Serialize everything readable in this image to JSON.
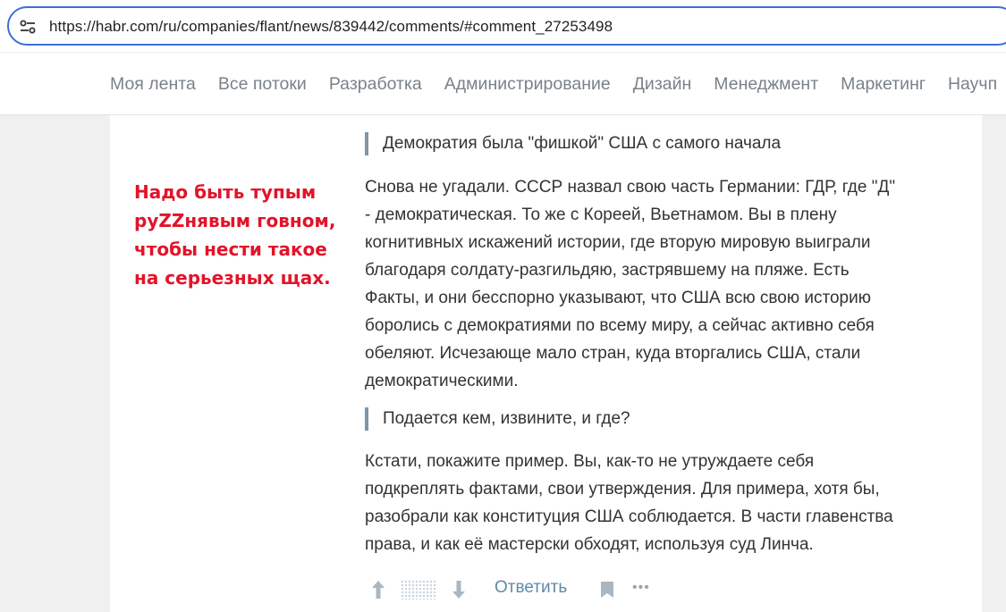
{
  "browser": {
    "url": "https://habr.com/ru/companies/flant/news/839442/comments/#comment_27253498"
  },
  "nav": {
    "items": [
      "Моя лента",
      "Все потоки",
      "Разработка",
      "Администрирование",
      "Дизайн",
      "Менеджмент",
      "Маркетинг",
      "Научп"
    ]
  },
  "side_note": {
    "lines": [
      "Надо быть тупым",
      "руZZнявым говном,",
      "чтобы нести такое",
      "на серьезных щах."
    ],
    "color": "#e3132a"
  },
  "comment": {
    "quote1": "Демократия была \"фишкой\" США с самого начала",
    "para1": [
      "Снова не угадали. СССР назвал свою часть Германии: ГДР, где \"Д\"",
      "- демократическая. То же с Кореей, Вьетнамом. Вы в плену",
      "когнитивных искажений истории, где вторую мировую выиграли",
      "благодаря солдату-разгильдяю, застрявшему на пляже. Есть",
      "Факты, и они бесспорно указывают, что США всю свою историю",
      "боролись с демократиями по всему миру, а сейчас активно себя",
      "обеляют. Исчезающе мало стран, куда вторгались США, стали",
      "демократическими."
    ],
    "quote2": "Подается кем, извините, и где?",
    "para2": [
      "Кстати, покажите пример. Вы, как-то не утруждаете себя",
      "подкреплять фактами, свои утверждения. Для примера, хотя бы,",
      "разобрали как конституция США соблюдается. В части главенства",
      "права, и как её мастерски обходят, используя суд Линча."
    ]
  },
  "actions": {
    "upvote_icon": "arrow-up-icon",
    "downvote_icon": "arrow-down-icon",
    "reply_label": "Ответить",
    "bookmark_icon": "bookmark-icon",
    "more_label": "•••",
    "accent": "#5e8aa8"
  }
}
